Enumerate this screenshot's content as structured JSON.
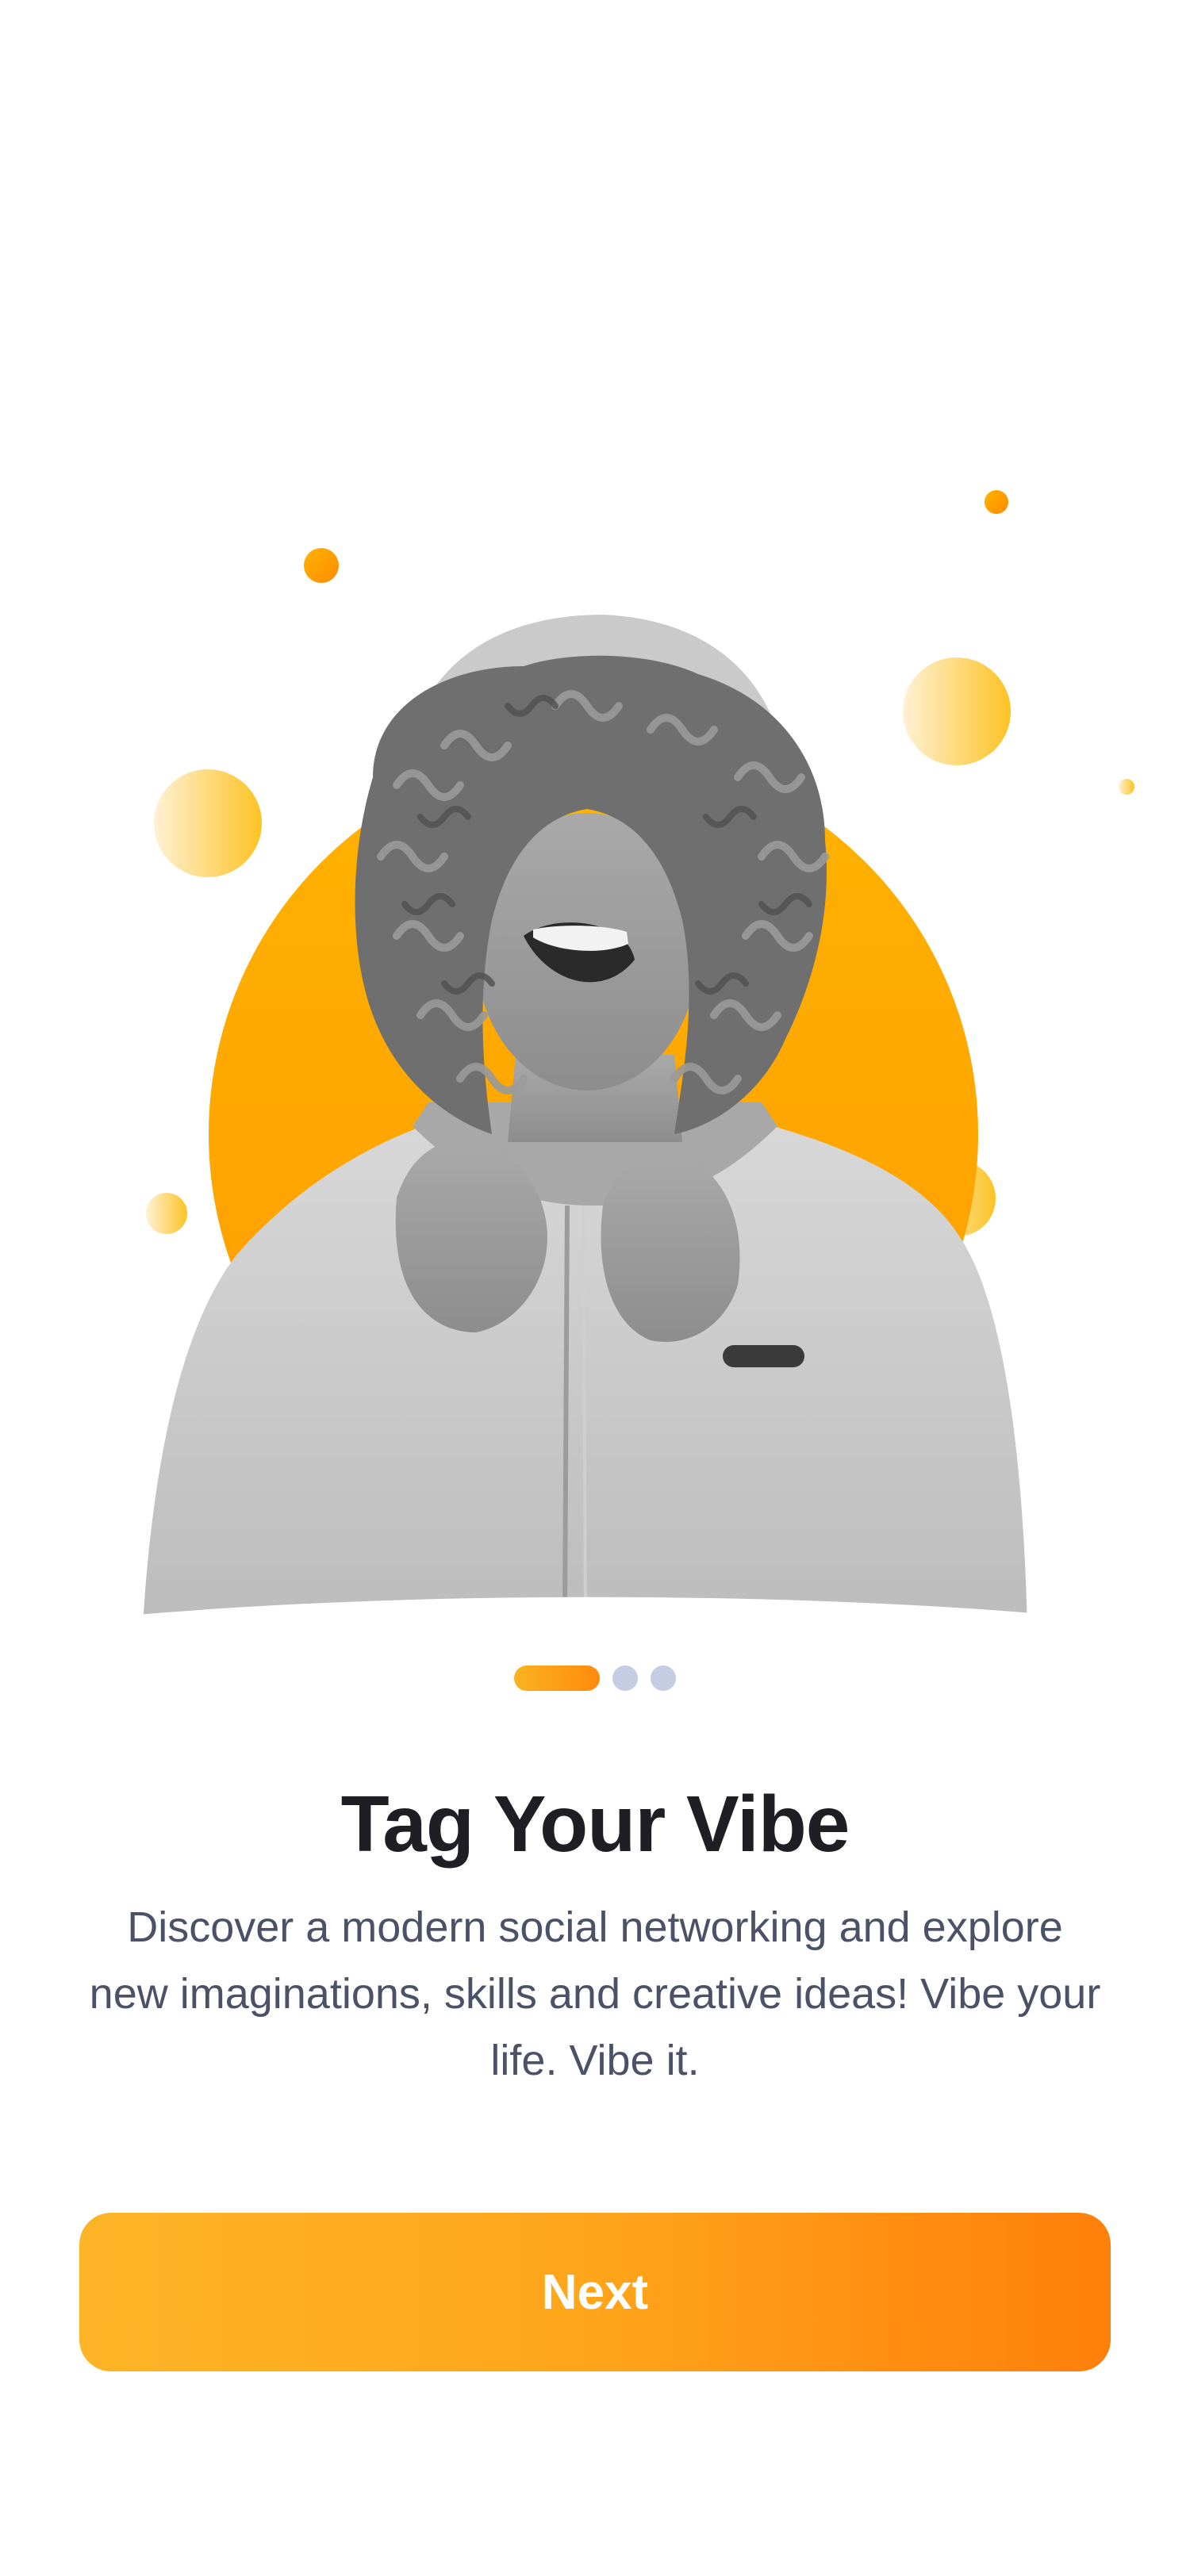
{
  "onboarding": {
    "title": "Tag Your Vibe",
    "description": "Discover a modern social networking and explore new imaginations, skills and creative ideas! Vibe your life. Vibe it.",
    "next_label": "Next",
    "illustration": "person-laughing-photo",
    "pager": {
      "total": 3,
      "active_index": 0
    }
  },
  "colors": {
    "accent_start": "#fcb526",
    "accent_end": "#ff7f0b",
    "circle_orange": "#ffa400",
    "dot_inactive": "#c5cde3",
    "title": "#1e1e24",
    "body_text": "#4b5268"
  }
}
